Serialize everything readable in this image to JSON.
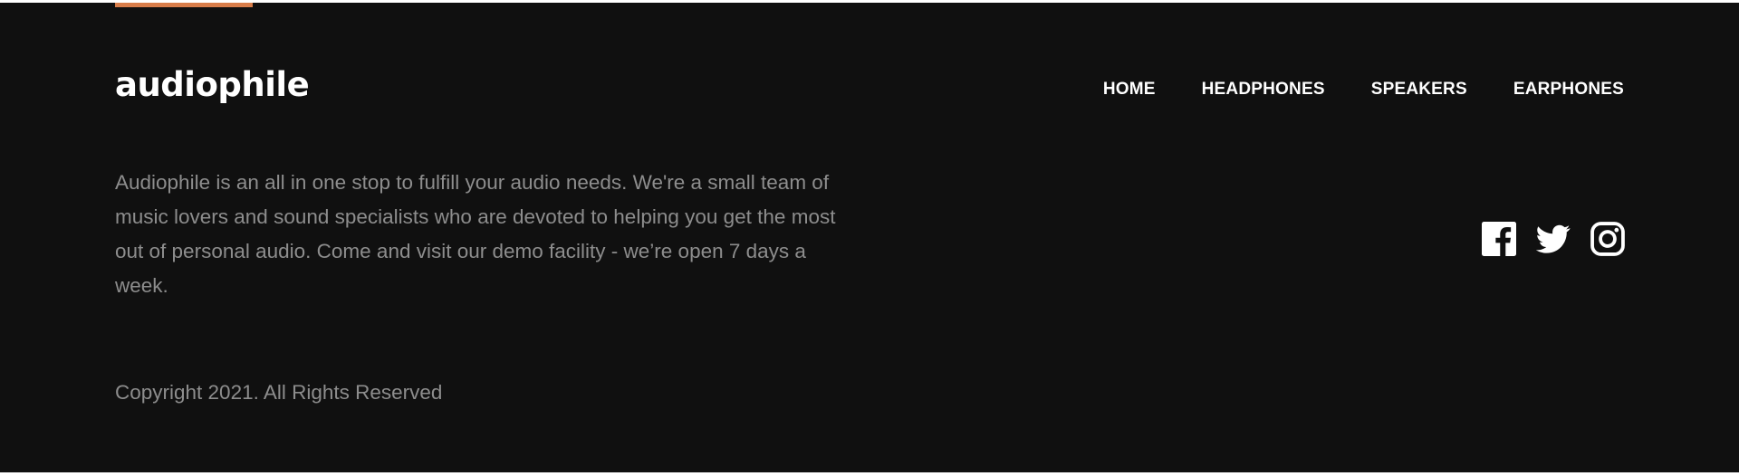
{
  "brand": {
    "logo_text": "audiophile",
    "accent_color": "#d87d4a"
  },
  "nav": {
    "items": [
      {
        "label": "HOME"
      },
      {
        "label": "HEADPHONES"
      },
      {
        "label": "SPEAKERS"
      },
      {
        "label": "EARPHONES"
      }
    ]
  },
  "footer": {
    "description": "Audiophile is an all in one stop to fulfill your audio needs. We're a small team of music lovers and sound specialists who are devoted to helping you get the most out of personal audio. Come and visit our demo facility - we’re open 7 days a week.",
    "copyright": "Copyright 2021. All Rights Reserved",
    "background_color": "#101010",
    "text_color": "#8d8d8d"
  },
  "social": {
    "icons": [
      "facebook-icon",
      "twitter-icon",
      "instagram-icon"
    ]
  }
}
